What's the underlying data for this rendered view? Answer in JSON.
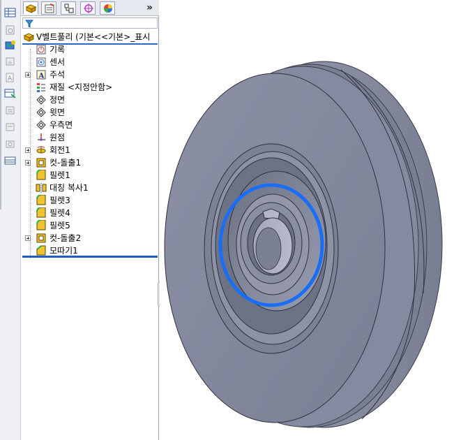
{
  "toolbar": {
    "tabs": [
      {
        "name": "featuremanager-tab",
        "icon": "featuremanager-icon",
        "active": true
      },
      {
        "name": "propertymanager-tab",
        "icon": "propertymanager-icon",
        "active": false
      },
      {
        "name": "configurationmanager-tab",
        "icon": "configurationmanager-icon",
        "active": false
      },
      {
        "name": "dimxpertmanager-tab",
        "icon": "dimxpert-icon",
        "active": false
      },
      {
        "name": "displaymanager-tab",
        "icon": "displaymanager-icon",
        "active": false
      }
    ],
    "more_label": "»"
  },
  "filter": {
    "icon": "filter-icon"
  },
  "tree": {
    "root": {
      "label": "V벨트풀리  (기본<<기본>_표시",
      "icon": "part-icon"
    },
    "items": [
      {
        "label": "기록",
        "icon": "history-icon",
        "expandable": false
      },
      {
        "label": "센서",
        "icon": "sensor-icon",
        "expandable": false
      },
      {
        "label": "주석",
        "icon": "annotation-icon",
        "expandable": true
      },
      {
        "label": "재질 <지정안함>",
        "icon": "material-icon",
        "expandable": false
      },
      {
        "label": "정면",
        "icon": "plane-icon",
        "expandable": false
      },
      {
        "label": "윗면",
        "icon": "plane-icon",
        "expandable": false
      },
      {
        "label": "우측면",
        "icon": "plane-icon",
        "expandable": false
      },
      {
        "label": "원점",
        "icon": "origin-icon",
        "expandable": false
      },
      {
        "label": "회전1",
        "icon": "revolve-icon",
        "expandable": true
      },
      {
        "label": "컷-돌출1",
        "icon": "cut-extrude-icon",
        "expandable": true
      },
      {
        "label": "필렛1",
        "icon": "fillet-icon",
        "expandable": false
      },
      {
        "label": "대칭 복사1",
        "icon": "mirror-icon",
        "expandable": false
      },
      {
        "label": "필렛3",
        "icon": "fillet-icon",
        "expandable": false
      },
      {
        "label": "필렛4",
        "icon": "fillet-icon",
        "expandable": false
      },
      {
        "label": "필렛5",
        "icon": "fillet-icon",
        "expandable": false
      },
      {
        "label": "컷-돌출2",
        "icon": "cut-extrude-icon",
        "expandable": true
      },
      {
        "label": "모따기1",
        "icon": "chamfer-icon",
        "expandable": false
      }
    ]
  },
  "side_strip": {
    "buttons": [
      "table-icon",
      "drawing-icon",
      "view-palette-icon",
      "appearance-icon",
      "note-icon",
      "export-icon",
      "layer-icon",
      "sheet-icon",
      "camera-icon",
      "table-icon"
    ]
  },
  "graphics": {
    "model": "pulley-model",
    "highlight_color": "#1a6ef5",
    "model_color": "#8a8fa3"
  }
}
